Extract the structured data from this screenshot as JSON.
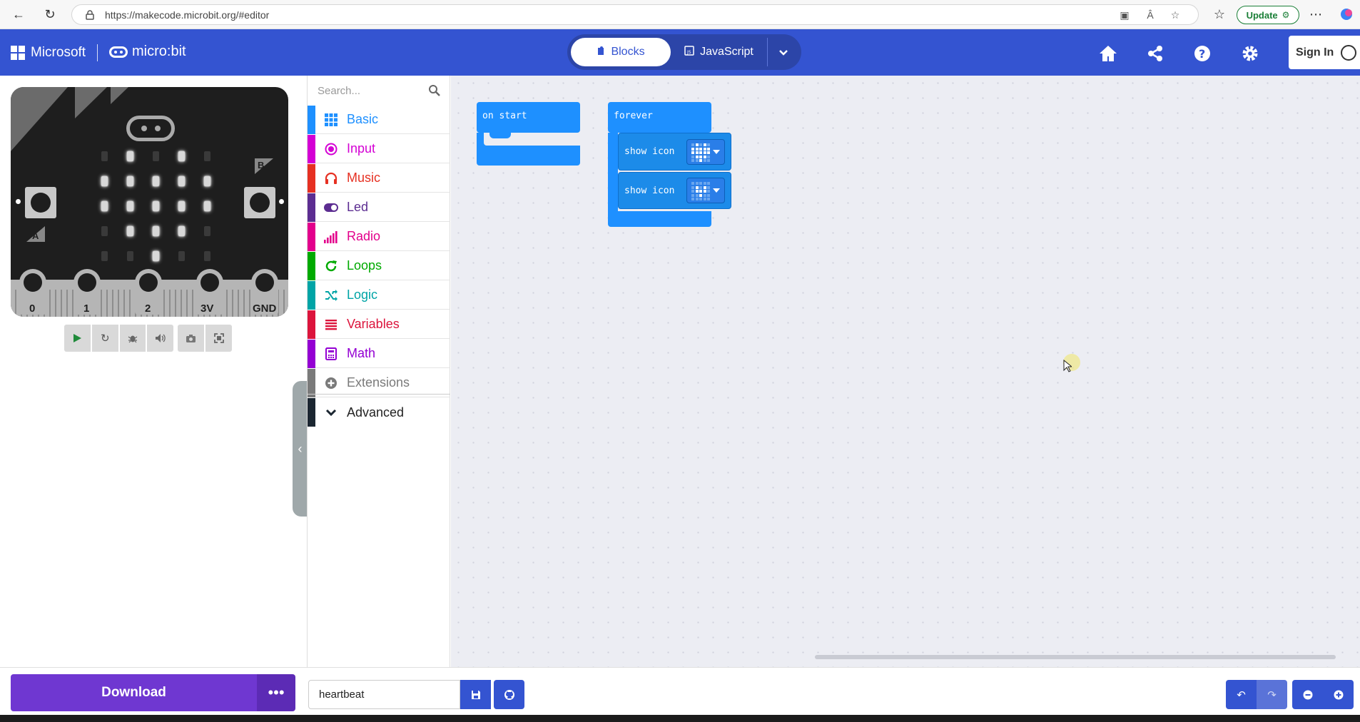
{
  "browser": {
    "url": "https://makecode.microbit.org/#editor",
    "update_label": "Update"
  },
  "header": {
    "brand": "Microsoft",
    "product": "micro:bit",
    "tab_blocks": "Blocks",
    "tab_javascript": "JavaScript",
    "sign_in": "Sign In",
    "icons": [
      "home-icon",
      "share-icon",
      "help-icon",
      "settings-icon"
    ]
  },
  "simulator": {
    "pin_labels": [
      "0",
      "1",
      "2",
      "3V",
      "GND"
    ],
    "button_a": "A",
    "button_b": "B",
    "led_matrix": [
      [
        0,
        1,
        0,
        1,
        0
      ],
      [
        1,
        1,
        1,
        1,
        1
      ],
      [
        1,
        1,
        1,
        1,
        1
      ],
      [
        0,
        1,
        1,
        1,
        0
      ],
      [
        0,
        0,
        1,
        0,
        0
      ]
    ],
    "toolbar_icons": [
      "play-icon",
      "restart-icon",
      "debug-icon",
      "mute-icon",
      "screenshot-icon",
      "fullscreen-icon"
    ]
  },
  "toolbox": {
    "search_placeholder": "Search...",
    "categories": [
      {
        "label": "Basic",
        "color": "#1e90ff",
        "icon": "grid-icon"
      },
      {
        "label": "Input",
        "color": "#d400d4",
        "icon": "target-icon"
      },
      {
        "label": "Music",
        "color": "#e63022",
        "icon": "headphones-icon"
      },
      {
        "label": "Led",
        "color": "#5c2d91",
        "icon": "toggle-icon"
      },
      {
        "label": "Radio",
        "color": "#e3008c",
        "icon": "signal-icon"
      },
      {
        "label": "Loops",
        "color": "#00aa00",
        "icon": "refresh-icon"
      },
      {
        "label": "Logic",
        "color": "#00a4a6",
        "icon": "shuffle-icon"
      },
      {
        "label": "Variables",
        "color": "#dc143c",
        "icon": "list-icon"
      },
      {
        "label": "Math",
        "color": "#9400d3",
        "icon": "calculator-icon"
      },
      {
        "label": "Extensions",
        "color": "#7a7a7a",
        "icon": "plus-circle-icon"
      }
    ],
    "advanced": {
      "label": "Advanced",
      "color": "#1b2631",
      "icon": "chevron-down-icon"
    }
  },
  "workspace": {
    "on_start_label": "on start",
    "forever_label": "forever",
    "show_icon_label": "show icon",
    "icon_1": [
      [
        0,
        1,
        0,
        1,
        0
      ],
      [
        1,
        1,
        1,
        1,
        1
      ],
      [
        1,
        1,
        1,
        1,
        1
      ],
      [
        0,
        1,
        1,
        1,
        0
      ],
      [
        0,
        0,
        1,
        0,
        0
      ]
    ],
    "icon_2": [
      [
        0,
        0,
        0,
        0,
        0
      ],
      [
        0,
        1,
        0,
        1,
        0
      ],
      [
        0,
        1,
        1,
        1,
        0
      ],
      [
        0,
        0,
        1,
        0,
        0
      ],
      [
        0,
        0,
        0,
        0,
        0
      ]
    ]
  },
  "bottom": {
    "download_label": "Download",
    "more_label": "•••",
    "project_name": "heartbeat"
  }
}
